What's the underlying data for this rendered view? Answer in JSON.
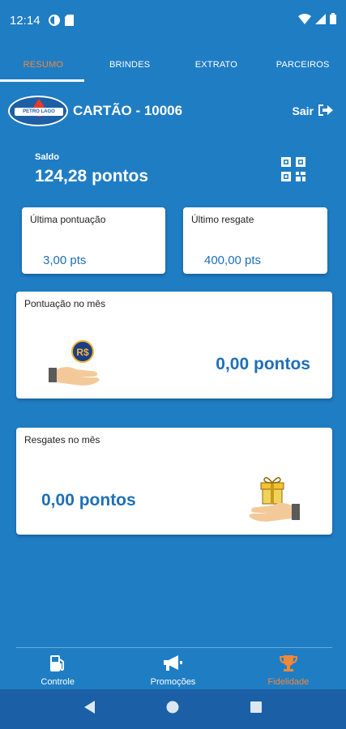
{
  "status_bar": {
    "time": "12:14"
  },
  "tabs": [
    {
      "label": "RESUMO",
      "active": true
    },
    {
      "label": "BRINDES",
      "active": false
    },
    {
      "label": "EXTRATO",
      "active": false
    },
    {
      "label": "PARCEIROS",
      "active": false
    }
  ],
  "header": {
    "logo_text": "PETRO LAGO",
    "card_title": "CARTÃO - 10006",
    "logout_label": "Sair"
  },
  "balance": {
    "label": "Saldo",
    "value": "124,28 pontos"
  },
  "last_points": {
    "label": "Última pontuação",
    "value": "3,00 pts"
  },
  "last_redeem": {
    "label": "Último resgate",
    "value": "400,00 pts"
  },
  "month_points": {
    "label": "Pontuação no mês",
    "value": "0,00 pontos",
    "coin_text": "R$"
  },
  "month_redeem": {
    "label": "Resgates no mês",
    "value": "0,00 pontos"
  },
  "bottom_nav": [
    {
      "label": "Controle",
      "icon": "fuel-pump-icon",
      "active": false
    },
    {
      "label": "Promoções",
      "icon": "megaphone-icon",
      "active": false
    },
    {
      "label": "Fidelidade",
      "icon": "trophy-icon",
      "active": true
    }
  ],
  "colors": {
    "background": "#1f7dc4",
    "accent": "#f0883a",
    "value_blue": "#1f6fb6",
    "system_nav": "#1b5fa6"
  }
}
